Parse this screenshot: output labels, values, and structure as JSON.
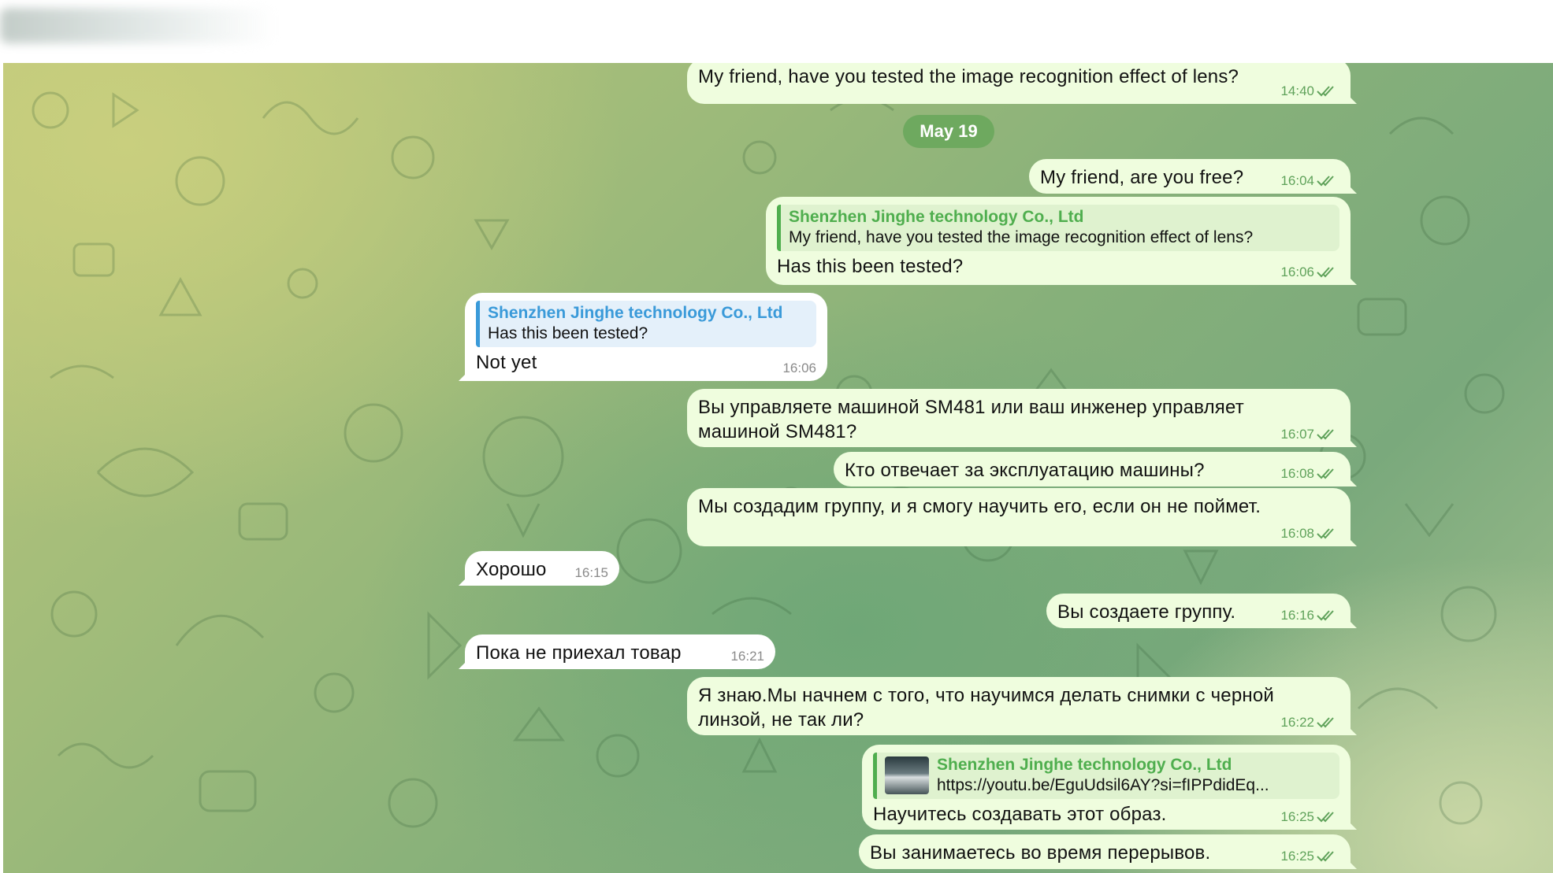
{
  "date_separator": "May 19",
  "messages": [
    {
      "text": "My friend, have you tested the image recognition effect of lens?",
      "time": "14:40"
    },
    {
      "text": "My friend, are you free?",
      "time": "16:04"
    },
    {
      "reply_name": "Shenzhen Jinghe technology Co., Ltd",
      "reply_text": "My friend, have you tested the image recognition effect of lens?",
      "text": "Has this been tested?",
      "time": "16:06"
    },
    {
      "reply_name": "Shenzhen Jinghe technology Co., Ltd",
      "reply_text": "Has this been tested?",
      "text": "Not yet",
      "time": "16:06"
    },
    {
      "text": "Вы управляете машиной SM481 или ваш инженер управляет машиной SM481?",
      "time": "16:07"
    },
    {
      "text": "Кто отвечает за эксплуатацию машины?",
      "time": "16:08"
    },
    {
      "text": "Мы создадим группу, и я смогу научить его, если он не поймет.",
      "time": "16:08"
    },
    {
      "text": "Хорошо",
      "time": "16:15"
    },
    {
      "text": "Вы создаете группу.",
      "time": "16:16"
    },
    {
      "text": "Пока не приехал товар",
      "time": "16:21"
    },
    {
      "text": "Я знаю.Мы начнем с того, что научимся делать снимки с черной линзой, не так ли?",
      "time": "16:22"
    },
    {
      "reply_name": "Shenzhen Jinghe technology Co., Ltd",
      "reply_text": "https://youtu.be/EguUdsil6AY?si=fIPPdidEq...",
      "text": "Научитесь создавать этот образ.",
      "time": "16:25"
    },
    {
      "text": "Вы занимаетесь во время перерывов.",
      "time": "16:25"
    }
  ],
  "icons": {
    "read_receipt": "double-check-icon"
  },
  "colors": {
    "outgoing_bubble": "#effdde",
    "incoming_bubble": "#ffffff",
    "accent_green": "#4fae4e",
    "accent_blue": "#3a9ad9",
    "date_pill": "#6ea95f"
  }
}
